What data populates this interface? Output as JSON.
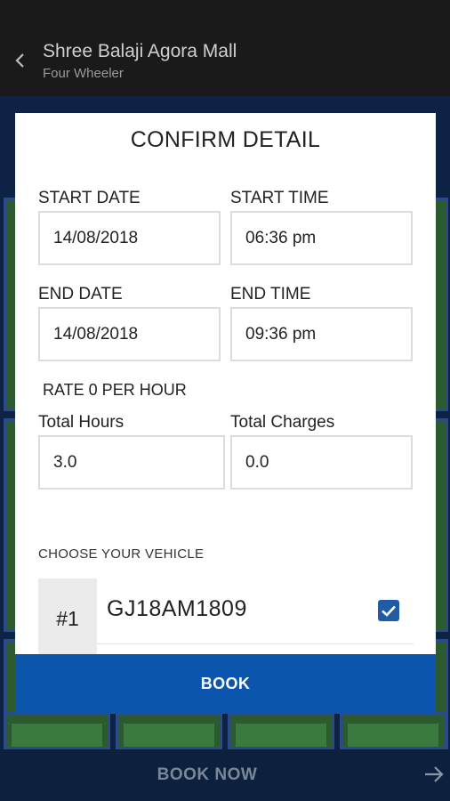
{
  "appbar": {
    "title": "Shree Balaji Agora Mall",
    "subtitle": "Four Wheeler"
  },
  "bottom_bar": {
    "book_now_label": "BOOK NOW"
  },
  "dialog": {
    "title": "CONFIRM DETAIL",
    "start_date_label": "START DATE",
    "start_date_value": "14/08/2018",
    "start_time_label": "START TIME",
    "start_time_value": "06:36 pm",
    "end_date_label": "END DATE",
    "end_date_value": "14/08/2018",
    "end_time_label": "END TIME",
    "end_time_value": "09:36 pm",
    "rate_label": "RATE 0 PER HOUR",
    "total_hours_label": "Total Hours",
    "total_hours_value": "3.0",
    "total_charges_label": "Total Charges",
    "total_charges_value": "0.0",
    "choose_vehicle_label": "CHOOSE YOUR VEHICLE",
    "vehicles": [
      {
        "number": "#1",
        "plate": "GJ18AM1809",
        "selected": true
      }
    ],
    "book_label": "BOOK"
  },
  "colors": {
    "appbar": "#1a1a1a",
    "background": "#0e2244",
    "primary_button": "#0b55ad",
    "checkbox": "#1f5ca8"
  }
}
